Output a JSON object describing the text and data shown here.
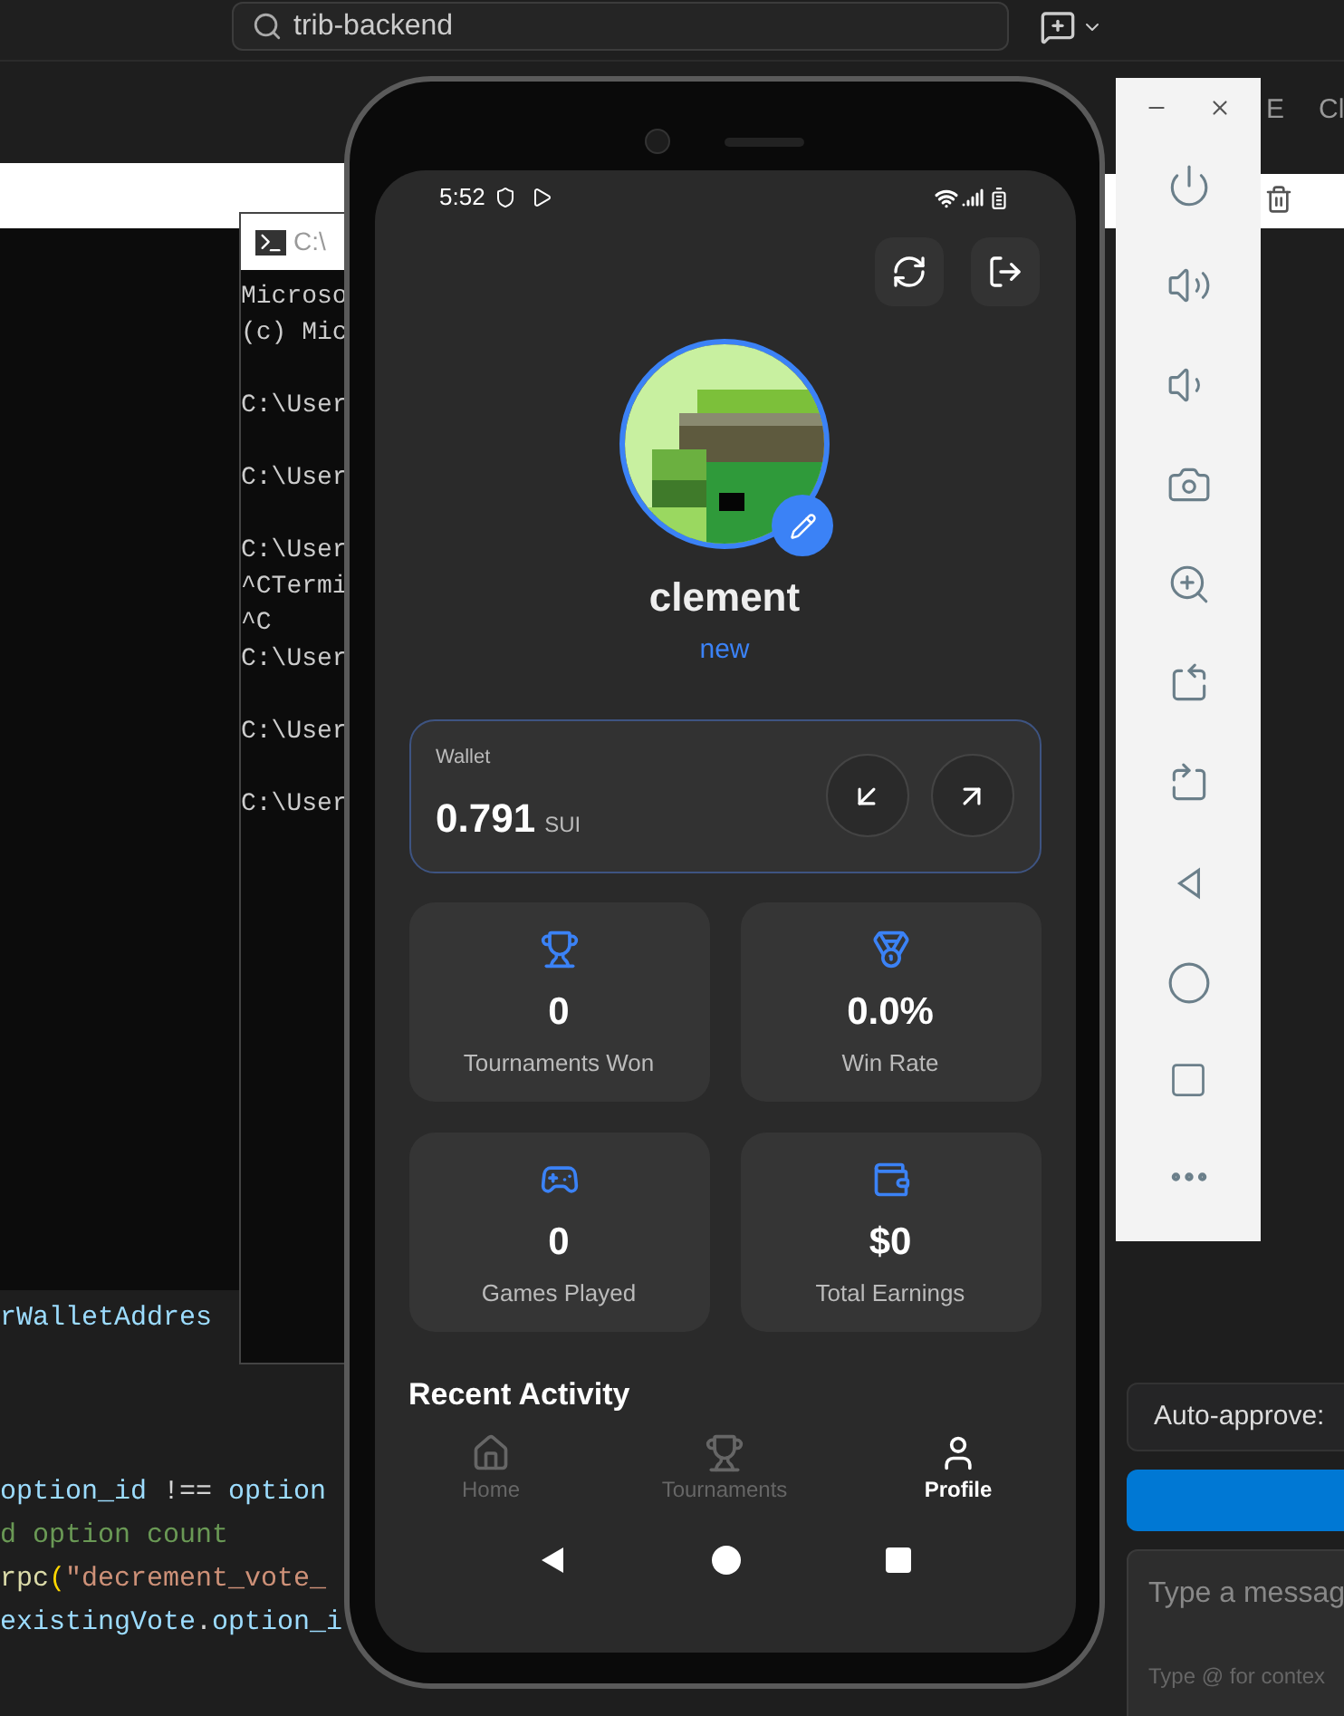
{
  "title_bar": {
    "search": {
      "label": "trib-backend"
    }
  },
  "editor": {
    "tab_fragments": [
      "E",
      "Cl"
    ],
    "code_blocks": [
      [
        {
          "tokens": [
            {
              "text": "rWalletAddres",
              "color": "#9cdcfe"
            }
          ]
        }
      ],
      [
        {
          "tokens": [
            {
              "text": "option_id",
              "color": "#9cdcfe"
            },
            {
              "text": " !== ",
              "color": "#d4d4d4"
            },
            {
              "text": "option",
              "color": "#9cdcfe"
            }
          ]
        },
        {
          "tokens": [
            {
              "text": "d option count",
              "color": "#6a9955"
            }
          ]
        },
        {
          "tokens": [
            {
              "text": "rpc",
              "color": "#dcdcaa"
            },
            {
              "text": "(",
              "color": "#ffd700"
            },
            {
              "text": "\"decrement_vote_",
              "color": "#ce9178"
            }
          ]
        },
        {
          "tokens": [
            {
              "text": "existingVote",
              "color": "#9cdcfe"
            },
            {
              "text": ".",
              "color": "#d4d4d4"
            },
            {
              "text": "option_i",
              "color": "#9cdcfe"
            }
          ]
        }
      ]
    ]
  },
  "terminal": {
    "title": "C:\\",
    "blocks": [
      [
        "Microso",
        "(c) Mic"
      ],
      [
        "C:\\User"
      ],
      [
        "C:\\User"
      ],
      [
        "C:\\User",
        "^CTermi",
        "^C",
        "C:\\User"
      ],
      [
        "C:\\User"
      ],
      [
        "C:\\User"
      ]
    ]
  },
  "phone": {
    "status_bar": {
      "time": "5:52"
    },
    "profile": {
      "name": "clement",
      "status": "new"
    },
    "wallet": {
      "label": "Wallet",
      "amount": "0.791",
      "unit": "SUI"
    },
    "stats": [
      {
        "kind": "trophy",
        "value": "0",
        "label": "Tournaments Won"
      },
      {
        "kind": "medal",
        "value": "0.0%",
        "label": "Win Rate"
      },
      {
        "kind": "gamepad",
        "value": "0",
        "label": "Games Played"
      },
      {
        "kind": "wallet",
        "value": "$0",
        "label": "Total Earnings"
      }
    ],
    "section_title": "Recent Activity",
    "nav": [
      {
        "kind": "home",
        "label": "Home",
        "selected": false
      },
      {
        "kind": "trophy",
        "label": "Tournaments",
        "selected": false
      },
      {
        "kind": "user",
        "label": "Profile",
        "selected": true
      }
    ]
  },
  "chat": {
    "auto_approve": "Auto-approve:",
    "placeholder": "Type a messag",
    "hint": "Type @ for contex"
  }
}
